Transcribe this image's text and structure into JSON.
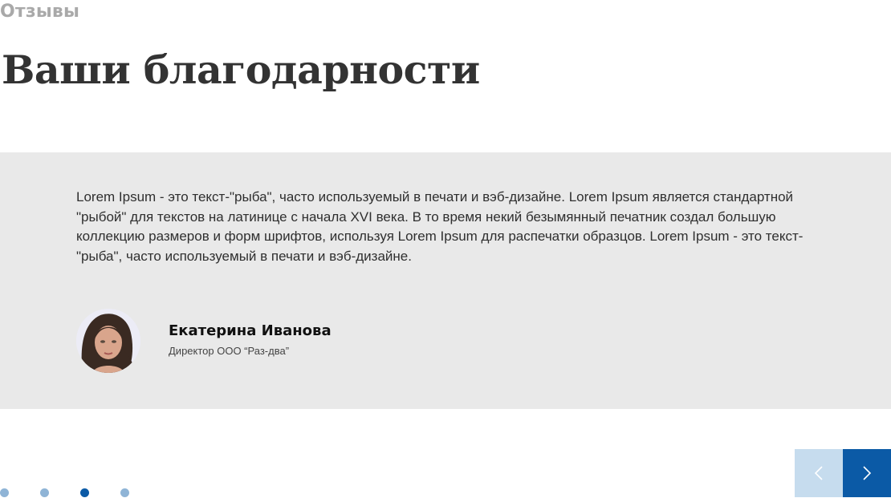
{
  "header": {
    "section_label": "Отзывы",
    "title": "Ваши благодарности"
  },
  "review": {
    "text": "Lorem Ipsum - это текст-\"рыба\", часто используемый в печати и вэб-дизайне. Lorem Ipsum является стандартной \"рыбой\" для текстов на латинице с начала XVI века. В то время некий безымянный печатник создал большую коллекцию размеров и форм шрифтов, используя Lorem Ipsum для распечатки образцов. Lorem Ipsum - это текст-\"рыба\", часто используемый в печати и вэб-дизайне.",
    "author_name": "Екатерина Иванова",
    "author_role": "Директор ООО “Раз-два”"
  },
  "pagination": {
    "total": 4,
    "active_index": 2
  },
  "navigation": {
    "prev_icon": "chevron-left-icon",
    "next_icon": "chevron-right-icon"
  },
  "colors": {
    "card_background": "#e9e9e9",
    "accent": "#0b5aa6",
    "accent_light": "#c6dcee",
    "dot_inactive": "#8fb4d6",
    "section_label": "#a9a9a9"
  }
}
